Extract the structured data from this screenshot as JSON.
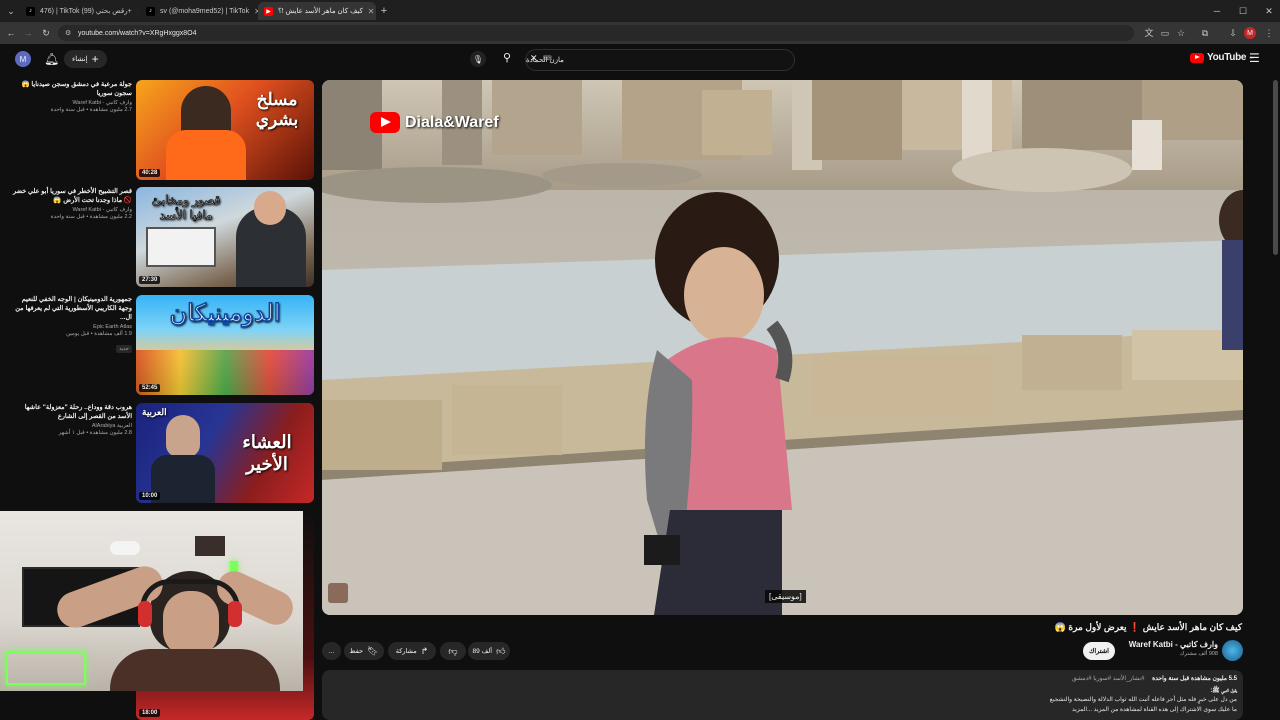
{
  "browser": {
    "tabs": [
      {
        "label": "476) | TikTok (رقص بحتي (99+"
      },
      {
        "label": "sv (@moha9med52) | TikTok"
      },
      {
        "label": "كيف كان ماهر الأسد عايش !؟"
      }
    ],
    "new_tab": "+",
    "url": "youtube.com/watch?v=XRgHxggx8O4",
    "profile_letter": "M"
  },
  "header": {
    "avatar_letter": "M",
    "create_label": "إنشاء",
    "search_value": "مازن الحمادة",
    "logo_text": "YouTube",
    "logo_sup": "SY"
  },
  "recommendations": [
    {
      "title": "جولة مرعبة في دمشق وسجن صيدنايا 😱 سجون سوريا",
      "channel": "وارف كاتبي - Waref Katbi",
      "views": "2.7 مليون مشاهدة • قبل سنة واحدة",
      "duration": "40:28",
      "thumb_text": "مسلخ بشري"
    },
    {
      "title": "قصر التشبيح الأخطر في سوريا أبو علي خضر 🚫 ماذا وجدنا تحت الأرض 😱",
      "channel": "وارف كاتبي - Waref Katbi",
      "views": "2.2 مليون مشاهدة • قبل سنة واحدة",
      "duration": "27:30",
      "thumb_text": "قصور ومخابئ مافيا الأسد"
    },
    {
      "title": "جمهورية الدومينيكان | الوجه الخفي للنعيم وجهة الكاريبي الأسطورية التي لم يعرفها من ال...",
      "channel": "Epic Earth Atlas",
      "views": "1.9 ألف مشاهدة • قبل يومين",
      "badge": "جديد",
      "duration": "52:45",
      "thumb_text": "الدومينيكان"
    },
    {
      "title": "هروب دقة ووداع.. رحلة \"معزولة\" عاشها الأسد من القصر إلى الشارع",
      "channel": "العربية AlArabiya",
      "views": "2.8 مليون مشاهدة • قبل ١ أشهر",
      "duration": "10:00",
      "thumb_text": "العشاء الأخير",
      "thumb_logo": "العربية"
    },
    {
      "duration": "18:00"
    }
  ],
  "player": {
    "watermark": "Diala&Waref",
    "caption": "[موسيقى]"
  },
  "video": {
    "title": "كيف كان ماهر الأسد عايش ❗ يعرض لأول مرة 😱",
    "channel_name": "وارف كاتبي - Waref Katbi",
    "subscribers": "908 ألف مشترك",
    "subscribe_label": "اشتراك",
    "likes": "89 ألف",
    "share_label": "مشاركة",
    "save_label": "حفظ",
    "more_label": "…"
  },
  "description": {
    "stats": "5.5 مليون مشاهدة  قبل سنة واحدة",
    "tags": "#بشار_الأسد #سوريا #دمشق",
    "line1": "يقول النبي ﷺ:",
    "line2": "من دل على خيرٍ فله مثل أجر فاعله أثبت الله ثواب الدلالة والنصيحة والتشجيع",
    "line3": "ما عليك سوى الاشتراك إلى هذه القناة لمشاهدة من المزيد ...المزيد"
  },
  "colors": {
    "background": "#0f0f0f",
    "surface": "#272727",
    "brand_red": "#ff0000",
    "text_primary": "#f1f1f1",
    "text_secondary": "#aaaaaa"
  }
}
